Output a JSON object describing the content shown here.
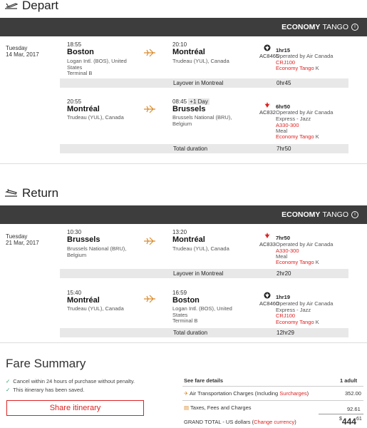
{
  "depart": {
    "title": "Depart",
    "cabin_bold": "ECONOMY",
    "cabin_name": "TANGO",
    "day": "Tuesday",
    "date": "14 Mar, 2017",
    "seg1": {
      "dep_time": "18:55",
      "dep_city": "Boston",
      "dep_airport1": "Logan Intl. (BOS), United",
      "dep_airport2": "States",
      "dep_terminal": "Terminal B",
      "arr_time": "20:10",
      "arr_city": "Montréal",
      "arr_airport": "Trudeau (YUL), Canada",
      "duration": "1hr15",
      "flight": "AC8465",
      "operated": "Operated by Air Canada",
      "aircraft": "CRJ100",
      "fare_class": "Economy Tango",
      "fare_code": "K"
    },
    "layover": {
      "label": "Layover in Montreal",
      "time": "0hr45"
    },
    "seg2": {
      "dep_time": "20:55",
      "dep_city": "Montréal",
      "dep_airport": "Trudeau (YUL), Canada",
      "arr_time": "08:45",
      "arr_plus": "+1 Day",
      "arr_city": "Brussels",
      "arr_airport1": "Brussels National (BRU),",
      "arr_airport2": "Belgium",
      "duration": "6hr50",
      "flight": "AC832",
      "operated1": "Operated by Air Canada",
      "operated2": "Express - Jazz",
      "aircraft": "A330-300",
      "meal": "Meal",
      "fare_class": "Economy Tango",
      "fare_code": "K"
    },
    "total": {
      "label": "Total duration",
      "time": "7hr50"
    }
  },
  "return": {
    "title": "Return",
    "cabin_bold": "ECONOMY",
    "cabin_name": "TANGO",
    "day": "Tuesday",
    "date": "21 Mar, 2017",
    "seg1": {
      "dep_time": "10:30",
      "dep_city": "Brussels",
      "dep_airport1": "Brussels National (BRU),",
      "dep_airport2": "Belgium",
      "arr_time": "13:20",
      "arr_city": "Montréal",
      "arr_airport": "Trudeau (YUL), Canada",
      "duration": "7hr50",
      "flight": "AC833",
      "operated": "Operated by Air Canada",
      "aircraft": "A330-300",
      "meal": "Meal",
      "fare_class": "Economy Tango",
      "fare_code": "K"
    },
    "layover": {
      "label": "Layover in Montreal",
      "time": "2hr20"
    },
    "seg2": {
      "dep_time": "15:40",
      "dep_city": "Montréal",
      "dep_airport": "Trudeau (YUL), Canada",
      "arr_time": "16:59",
      "arr_city": "Boston",
      "arr_airport1": "Logan Intl. (BOS), United",
      "arr_airport2": "States",
      "arr_terminal": "Terminal B",
      "duration": "1hr19",
      "flight": "AC8460",
      "operated1": "Operated by Air Canada",
      "operated2": "Express - Jazz",
      "aircraft": "CRJ100",
      "fare_class": "Economy Tango",
      "fare_code": "K"
    },
    "total": {
      "label": "Total duration",
      "time": "12hr29"
    }
  },
  "fare": {
    "title": "Fare Summary",
    "check1": "Cancel within 24 hours of purchase without penalty.",
    "check2": "This itinerary has been saved.",
    "share": "Share itinerary",
    "see_details": "See fare details",
    "adults": "1 adult",
    "air_label": "Air Transportation Charges (Including ",
    "surcharges": "Surcharges",
    "air_close": ")",
    "air_value": "352.00",
    "taxes_label": "Taxes, Fees and Charges",
    "taxes_value": "92.61",
    "grand_label": "GRAND TOTAL - US dollars (",
    "change_currency": "Change currency",
    "grand_close": ")",
    "grand_currency": "$",
    "grand_whole": "444",
    "grand_cents": "61"
  },
  "colors": {
    "accent": "#d22222",
    "bar": "#3d3d3d",
    "row": "#e8e8e8",
    "check": "#2a9d6a"
  },
  "icons": [
    "plane-depart-icon",
    "plane-return-icon",
    "flight-arrow-icon",
    "air-canada-logo-icon",
    "info-icon",
    "checkmark-icon",
    "plane-small-icon",
    "receipt-icon"
  ]
}
